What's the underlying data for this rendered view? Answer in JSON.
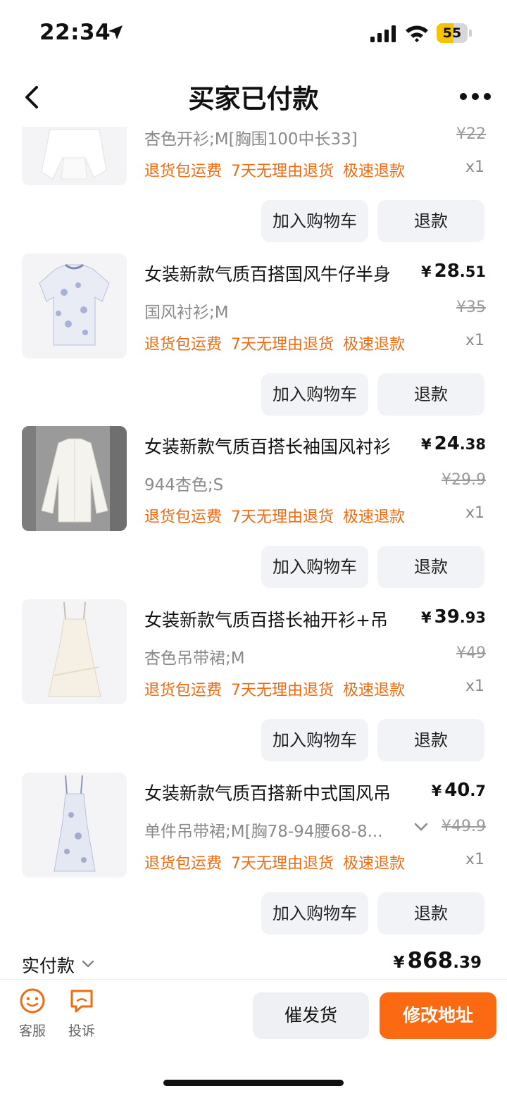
{
  "status": {
    "time": "22:34",
    "battery": "55",
    "battery_level": 0.55
  },
  "nav": {
    "title": "买家已付款",
    "back_icon": "chevron-left-icon",
    "more_icon": "more-dots-icon"
  },
  "item_buttons": {
    "add_cart": "加入购物车",
    "refund": "退款"
  },
  "items": [
    {
      "title": "",
      "price_int": "",
      "price_dec": "",
      "sku": "杏色开衫;M[胸围100中长33]",
      "orig": "¥22",
      "qty": "x1",
      "tags": [
        "退货包运费",
        "7天无理由退货",
        "极速退款"
      ]
    },
    {
      "title": "女装新款气质百搭国风牛仔半身",
      "price_int": "28",
      "price_dec": ".51",
      "sku": "国风衬衫;M",
      "orig": "¥35",
      "qty": "x1",
      "tags": [
        "退货包运费",
        "7天无理由退货",
        "极速退款"
      ]
    },
    {
      "title": "女装新款气质百搭长袖国风衬衫",
      "price_int": "24",
      "price_dec": ".38",
      "sku": "944杏色;S",
      "orig": "¥29.9",
      "qty": "x1",
      "tags": [
        "退货包运费",
        "7天无理由退货",
        "极速退款"
      ]
    },
    {
      "title": "女装新款气质百搭长袖开衫+吊",
      "price_int": "39",
      "price_dec": ".93",
      "sku": "杏色吊带裙;M",
      "orig": "¥49",
      "qty": "x1",
      "tags": [
        "退货包运费",
        "7天无理由退货",
        "极速退款"
      ]
    },
    {
      "title": "女装新款气质百搭新中式国风吊",
      "price_int": "40",
      "price_dec": ".7",
      "sku": "单件吊带裙;M[胸78-94腰68-8...",
      "orig": "¥49.9",
      "qty": "x1",
      "tags": [
        "退货包运费",
        "7天无理由退货",
        "极速退款"
      ]
    }
  ],
  "currency": "¥",
  "total": {
    "label": "实付款",
    "int": "868",
    "dec": ".39"
  },
  "bottom": {
    "service": "客服",
    "complaint": "投诉",
    "urge": "催发货",
    "change_address": "修改地址"
  },
  "colors": {
    "accent": "#fb6a12",
    "tag": "#f06a10"
  }
}
